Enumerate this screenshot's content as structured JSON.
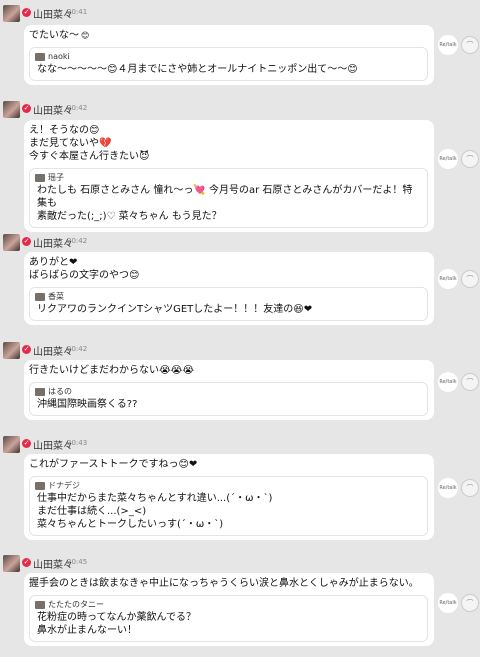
{
  "posts": [
    {
      "author": "山田菜々",
      "time": "20:41",
      "text": "でたいな〜",
      "emoji": "😊",
      "reply_user": "naoki",
      "reply_text": "なな〜〜〜〜〜😊４月までにさや姉とオールナイトニッポン出て〜〜😊",
      "side_label": "Re/talk",
      "side_icon": "speech-bubble-icon"
    },
    {
      "author": "山田菜々",
      "time": "20:42",
      "text": "え！そうなの😊\nまだ見てないや💔\n今すぐ本屋さん行きたい😈",
      "emoji": "",
      "reply_user": "瑶子",
      "reply_text": "わたしも 石原さとみさん 憧れ〜っ💘 今月号のar 石原さとみさんがカバーだよ！特集も\n素敵だった(;_;)♡ 菜々ちゃん もう見た？",
      "side_label": "Re/talk",
      "side_icon": "speech-bubble-icon"
    },
    {
      "author": "山田菜々",
      "time": "20:42",
      "text": "ありがと❤\nばらばらの文字のやつ😊",
      "emoji": "",
      "reply_user": "香菜",
      "reply_text": "リクアワのランクインTシャツGETしたよー！！！友達の😆❤",
      "side_label": "Re/talk",
      "side_icon": "speech-bubble-icon"
    },
    {
      "author": "山田菜々",
      "time": "20:42",
      "text": "行きたいけどまだわからない😭😭😭",
      "emoji": "",
      "reply_user": "はるの",
      "reply_text": "沖縄国際映画祭くる??",
      "side_label": "Re/talk",
      "side_icon": "speech-bubble-icon"
    },
    {
      "author": "山田菜々",
      "time": "20:43",
      "text": "これがファーストトークですねっ😊❤",
      "emoji": "",
      "reply_user": "ドナデジ",
      "reply_text": "仕事中だからまた菜々ちゃんとすれ違い...(´・ω・`)\nまだ仕事は続く...(>_<)\n菜々ちゃんとトークしたいっす(´・ω・`)",
      "side_label": "Re/talk",
      "side_icon": "speech-bubble-icon"
    },
    {
      "author": "山田菜々",
      "time": "20:45",
      "text": "握手会のときは飲まなきゃ中止になっちゃうくらい涙と鼻水とくしゃみが止まらない。",
      "emoji": "",
      "reply_user": "たたたのタニー",
      "reply_text": "花粉症の時ってなんか薬飲んでる？\n鼻水が止まんなーい！",
      "side_label": "Re/talk",
      "side_icon": "speech-bubble-icon"
    }
  ]
}
